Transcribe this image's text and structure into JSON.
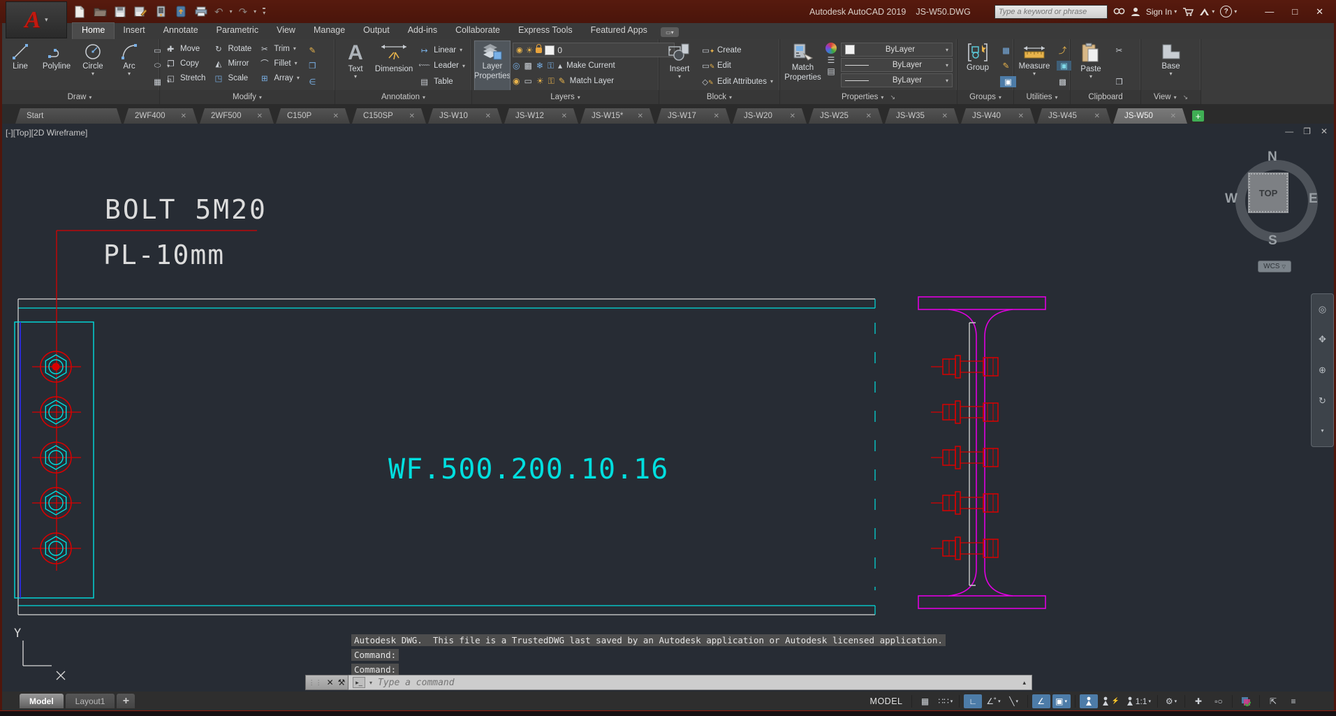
{
  "title_bar": {
    "app_name": "Autodesk AutoCAD 2019",
    "doc_name": "JS-W50.DWG",
    "search_placeholder": "Type a keyword or phrase",
    "sign_in_label": "Sign In"
  },
  "ribbon_tabs": {
    "active": "Home",
    "items": [
      {
        "label": "Home"
      },
      {
        "label": "Insert"
      },
      {
        "label": "Annotate"
      },
      {
        "label": "Parametric"
      },
      {
        "label": "View"
      },
      {
        "label": "Manage"
      },
      {
        "label": "Output"
      },
      {
        "label": "Add-ins"
      },
      {
        "label": "Collaborate"
      },
      {
        "label": "Express Tools"
      },
      {
        "label": "Featured Apps"
      }
    ]
  },
  "ribbon": {
    "draw": {
      "label": "Draw",
      "tools": [
        "Line",
        "Polyline",
        "Circle",
        "Arc"
      ]
    },
    "modify": {
      "label": "Modify",
      "row1": [
        "Move",
        "Rotate",
        "Trim"
      ],
      "row2": [
        "Copy",
        "Mirror",
        "Fillet"
      ],
      "row3": [
        "Stretch",
        "Scale",
        "Array"
      ]
    },
    "annotation": {
      "label": "Annotation",
      "big": [
        "Text",
        "Dimension"
      ],
      "side": [
        "Linear",
        "Leader",
        "Table"
      ]
    },
    "layers": {
      "label": "Layers",
      "big_line1": "Layer",
      "big_line2": "Properties",
      "combo_value": "0",
      "side": [
        "Make Current",
        "Match Layer"
      ]
    },
    "block": {
      "label": "Block",
      "big": "Insert",
      "side": [
        "Create",
        "Edit",
        "Edit Attributes"
      ]
    },
    "properties": {
      "label": "Properties",
      "big_line1": "Match",
      "big_line2": "Properties",
      "dropdowns": [
        "ByLayer",
        "ByLayer",
        "ByLayer"
      ]
    },
    "groups": {
      "label": "Groups",
      "big": "Group"
    },
    "utilities": {
      "label": "Utilities",
      "big": "Measure"
    },
    "clipboard": {
      "label": "Clipboard",
      "big": "Paste"
    },
    "view": {
      "label": "View",
      "big": "Base"
    }
  },
  "file_tabs": {
    "active": "JS-W50",
    "items": [
      {
        "label": "Start"
      },
      {
        "label": "2WF400"
      },
      {
        "label": "2WF500"
      },
      {
        "label": "C150P"
      },
      {
        "label": "C150SP"
      },
      {
        "label": "JS-W10"
      },
      {
        "label": "JS-W12"
      },
      {
        "label": "JS-W15*"
      },
      {
        "label": "JS-W17"
      },
      {
        "label": "JS-W20"
      },
      {
        "label": "JS-W25"
      },
      {
        "label": "JS-W35"
      },
      {
        "label": "JS-W40"
      },
      {
        "label": "JS-W45"
      },
      {
        "label": "JS-W50"
      }
    ]
  },
  "viewport": {
    "view_label": "[-][Top][2D Wireframe]",
    "viewcube": {
      "north": "N",
      "east": "E",
      "south": "S",
      "west": "W",
      "top": "TOP",
      "wcs": "WCS"
    },
    "drawing": {
      "bolt_note": "BOLT 5M20",
      "plate_note": "PL-10mm",
      "beam_label": "WF.500.200.10.16",
      "ucs_y_label": "Y",
      "colors": {
        "cyan": "#00dfdf",
        "red": "#d90000",
        "magenta": "#e000e0",
        "blue": "#2a2ad0",
        "white": "#d8d8d8"
      }
    }
  },
  "command": {
    "history": [
      "Autodesk DWG.  This file is a TrustedDWG last saved by an Autodesk application or Autodesk licensed application.",
      "Command:",
      "Command:"
    ],
    "placeholder": "Type a command"
  },
  "status_bar": {
    "layout_tabs": [
      "Model",
      "Layout1"
    ],
    "model_button": "MODEL",
    "annotation_scale": "1:1"
  }
}
